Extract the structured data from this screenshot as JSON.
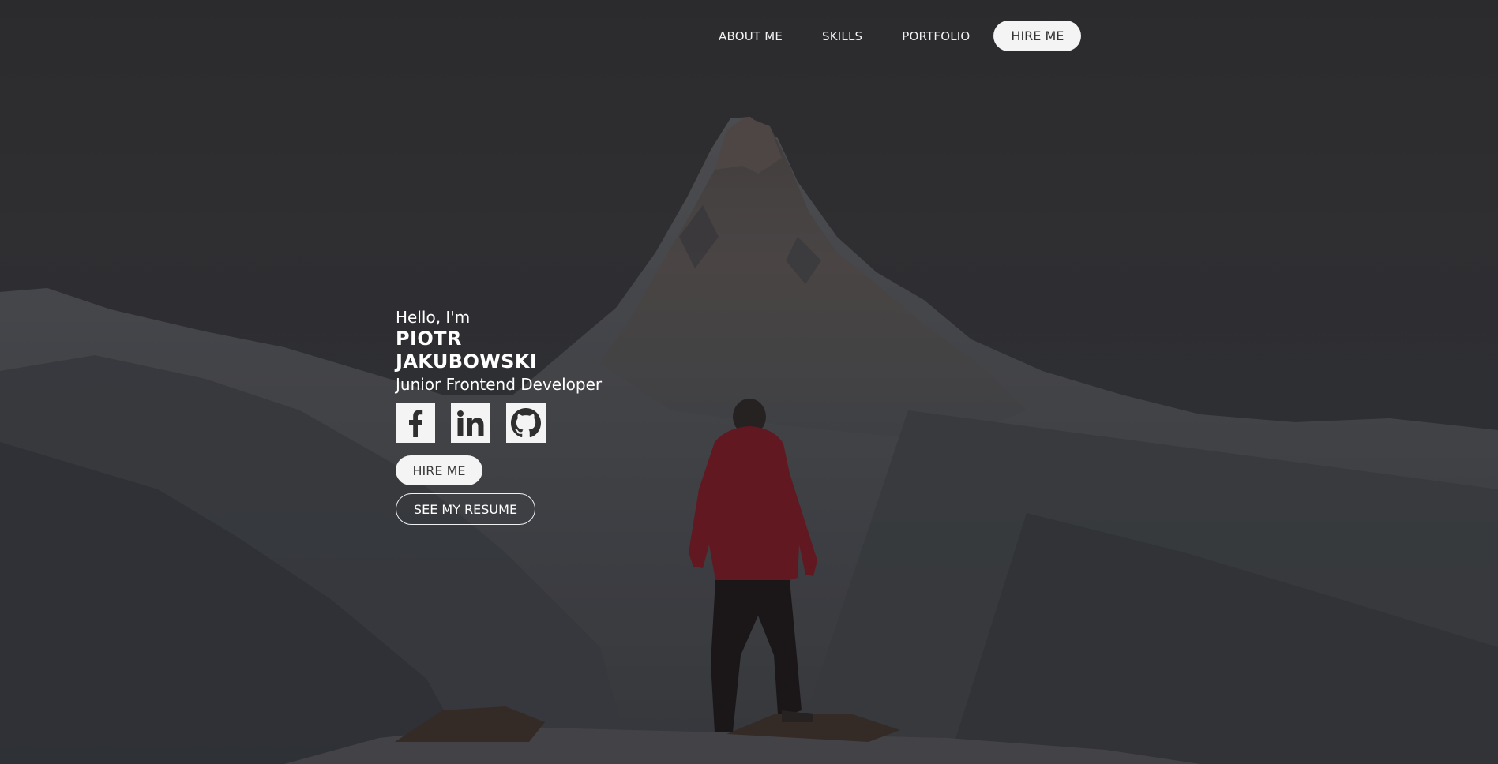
{
  "nav": {
    "about": "ABOUT ME",
    "skills": "SKILLS",
    "portfolio": "PORTFOLIO",
    "hire": "HIRE ME"
  },
  "hero": {
    "greeting": "Hello, I'm",
    "first_name": "PIOTR",
    "last_name": "JAKUBOWSKI",
    "role": "Junior Frontend Developer",
    "hire_button": "HIRE ME",
    "resume_button": "SEE MY RESUME"
  },
  "socials": [
    {
      "icon": "facebook-icon"
    },
    {
      "icon": "linkedin-icon"
    },
    {
      "icon": "github-icon"
    }
  ],
  "colors": {
    "background": "#2d2d2f",
    "button_fill": "#f4f4f4",
    "text": "#ffffff",
    "jacket": "#6e1a22"
  }
}
